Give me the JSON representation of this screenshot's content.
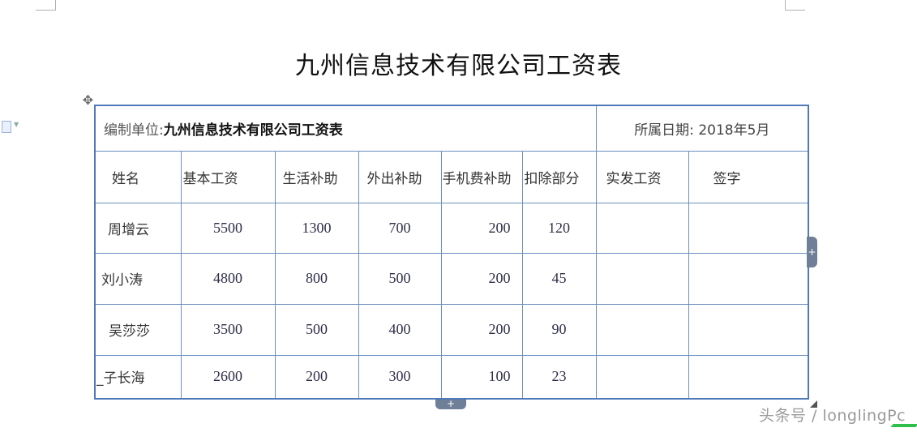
{
  "document": {
    "title": "九州信息技术有限公司工资表"
  },
  "table": {
    "org_label": "编制单位:",
    "org_name": "九州信息技术有限公司工资表",
    "date_text": "所属日期: 2018年5月",
    "headers": [
      "姓名",
      "基本工资",
      "生活补助",
      "外出补助",
      "手机费补助",
      "扣除部分",
      "实发工资",
      "签字"
    ],
    "rows": [
      [
        "周增云",
        "5500",
        "1300",
        "700",
        "200",
        "120",
        "",
        ""
      ],
      [
        "刘小涛",
        "4800",
        "800",
        "500",
        "200",
        "45",
        "",
        ""
      ],
      [
        "吴莎莎",
        "3500",
        "500",
        "400",
        "200",
        "90",
        "",
        ""
      ],
      [
        "_子长海",
        "2600",
        "200",
        "300",
        "100",
        "23",
        "",
        ""
      ]
    ]
  },
  "controls": {
    "move_symbol": "✥",
    "add_symbol": "+"
  },
  "watermark": "头条号 / longlingPc"
}
